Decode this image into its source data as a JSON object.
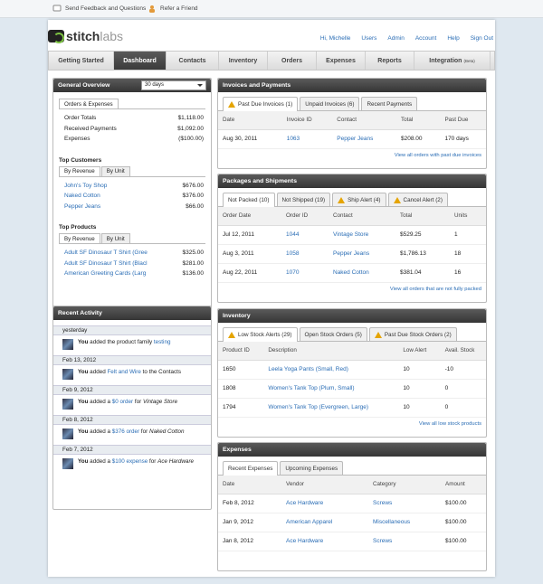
{
  "topbar": {
    "feedback": "Send Feedback and Questions",
    "refer": "Refer a Friend"
  },
  "brand": {
    "part1": "stitch",
    "part2": "labs"
  },
  "user": {
    "greeting": "Hi, Michelle",
    "links": [
      "Users",
      "Admin",
      "Account",
      "Help",
      "Sign Out"
    ]
  },
  "nav": {
    "tabs": [
      "Getting Started",
      "Dashboard",
      "Contacts",
      "Inventory",
      "Orders",
      "Expenses",
      "Reports",
      "Integration"
    ],
    "beta": "(Beta)",
    "active": "Dashboard"
  },
  "overview": {
    "title": "General Overview",
    "period": "30 days",
    "tab": "Orders & Expenses",
    "rows": [
      {
        "k": "Order Totals",
        "v": "$1,118.00"
      },
      {
        "k": "Received Payments",
        "v": "$1,092.00"
      },
      {
        "k": "Expenses",
        "v": "($100.00)"
      }
    ],
    "customers_title": "Top Customers",
    "by_revenue": "By Revenue",
    "by_unit": "By Unit",
    "customers": [
      {
        "k": "John's Toy Shop",
        "v": "$676.00"
      },
      {
        "k": "Naked Cotton",
        "v": "$376.00"
      },
      {
        "k": "Pepper Jeans",
        "v": "$66.00"
      }
    ],
    "products_title": "Top Products",
    "products": [
      {
        "k": "Adult SF Dinosaur T Shirt (Gree",
        "v": "$325.00"
      },
      {
        "k": "Adult SF Dinosaur T Shirt (Blacl",
        "v": "$281.00"
      },
      {
        "k": "American Greeting Cards (Larg",
        "v": "$136.00"
      }
    ]
  },
  "activity": {
    "title": "Recent Activity",
    "groups": [
      {
        "date": "yesterday",
        "you": "You",
        "pre": " added the product family ",
        "link": "testing",
        "post": ""
      },
      {
        "date": "Feb 13, 2012",
        "you": "You",
        "pre": " added ",
        "link": "Felt and Wire",
        "post": " to the Contacts"
      },
      {
        "date": "Feb 9, 2012",
        "you": "You",
        "pre": " added a ",
        "link": "$0 order",
        "post": " for ",
        "em": "Vintage Store"
      },
      {
        "date": "Feb 8, 2012",
        "you": "You",
        "pre": " added a ",
        "link": "$376 order",
        "post": " for ",
        "em": "Naked Cotton"
      },
      {
        "date": "Feb 7, 2012",
        "you": "You",
        "pre": " added a ",
        "link": "$100 expense",
        "post": " for ",
        "em": "Ace Hardware"
      }
    ]
  },
  "invoices": {
    "title": "Invoices and Payments",
    "tabs": [
      "Past Due Invoices (1)",
      "Unpaid Invoices (6)",
      "Recent Payments"
    ],
    "cols": [
      "Date",
      "Invoice ID",
      "Contact",
      "Total",
      "Past Due"
    ],
    "rows": [
      [
        "Aug 30, 2011",
        "1063",
        "Pepper Jeans",
        "$208.00",
        "170 days"
      ]
    ],
    "footer": "View all orders with past due invoices"
  },
  "packages": {
    "title": "Packages and Shipments",
    "tabs": [
      "Not Packed (10)",
      "Not Shipped (19)",
      "Ship Alert (4)",
      "Cancel Alert (2)"
    ],
    "cols": [
      "Order Date",
      "Order ID",
      "Contact",
      "Total",
      "Units"
    ],
    "rows": [
      [
        "Jul 12, 2011",
        "1044",
        "Vintage Store",
        "$529.25",
        "1"
      ],
      [
        "Aug 3, 2011",
        "1058",
        "Pepper Jeans",
        "$1,786.13",
        "18"
      ],
      [
        "Aug 22, 2011",
        "1070",
        "Naked Cotton",
        "$381.04",
        "16"
      ]
    ],
    "footer": "View all orders that are not fully packed"
  },
  "inventory": {
    "title": "Inventory",
    "tabs": [
      "Low Stock Alerts (29)",
      "Open Stock Orders (5)",
      "Past Due Stock Orders (2)"
    ],
    "cols": [
      "Product ID",
      "Description",
      "Low Alert",
      "Avail. Stock"
    ],
    "rows": [
      [
        "1650",
        "Leela Yoga Pants (Small, Red)",
        "10",
        "-10"
      ],
      [
        "1808",
        "Women's Tank Top (Plum, Small)",
        "10",
        "0"
      ],
      [
        "1794",
        "Women's Tank Top (Evergreen, Large)",
        "10",
        "0"
      ]
    ],
    "footer": "View all low stock products"
  },
  "expenses": {
    "title": "Expenses",
    "tabs": [
      "Recent Expenses",
      "Upcoming Expenses"
    ],
    "cols": [
      "Date",
      "Vendor",
      "Category",
      "Amount"
    ],
    "rows": [
      [
        "Feb 8, 2012",
        "Ace Hardware",
        "Screws",
        "$100.00"
      ],
      [
        "Jan 9, 2012",
        "American Apparel",
        "Miscellaneous",
        "$100.00"
      ],
      [
        "Jan 8, 2012",
        "Ace Hardware",
        "Screws",
        "$100.00"
      ]
    ]
  }
}
